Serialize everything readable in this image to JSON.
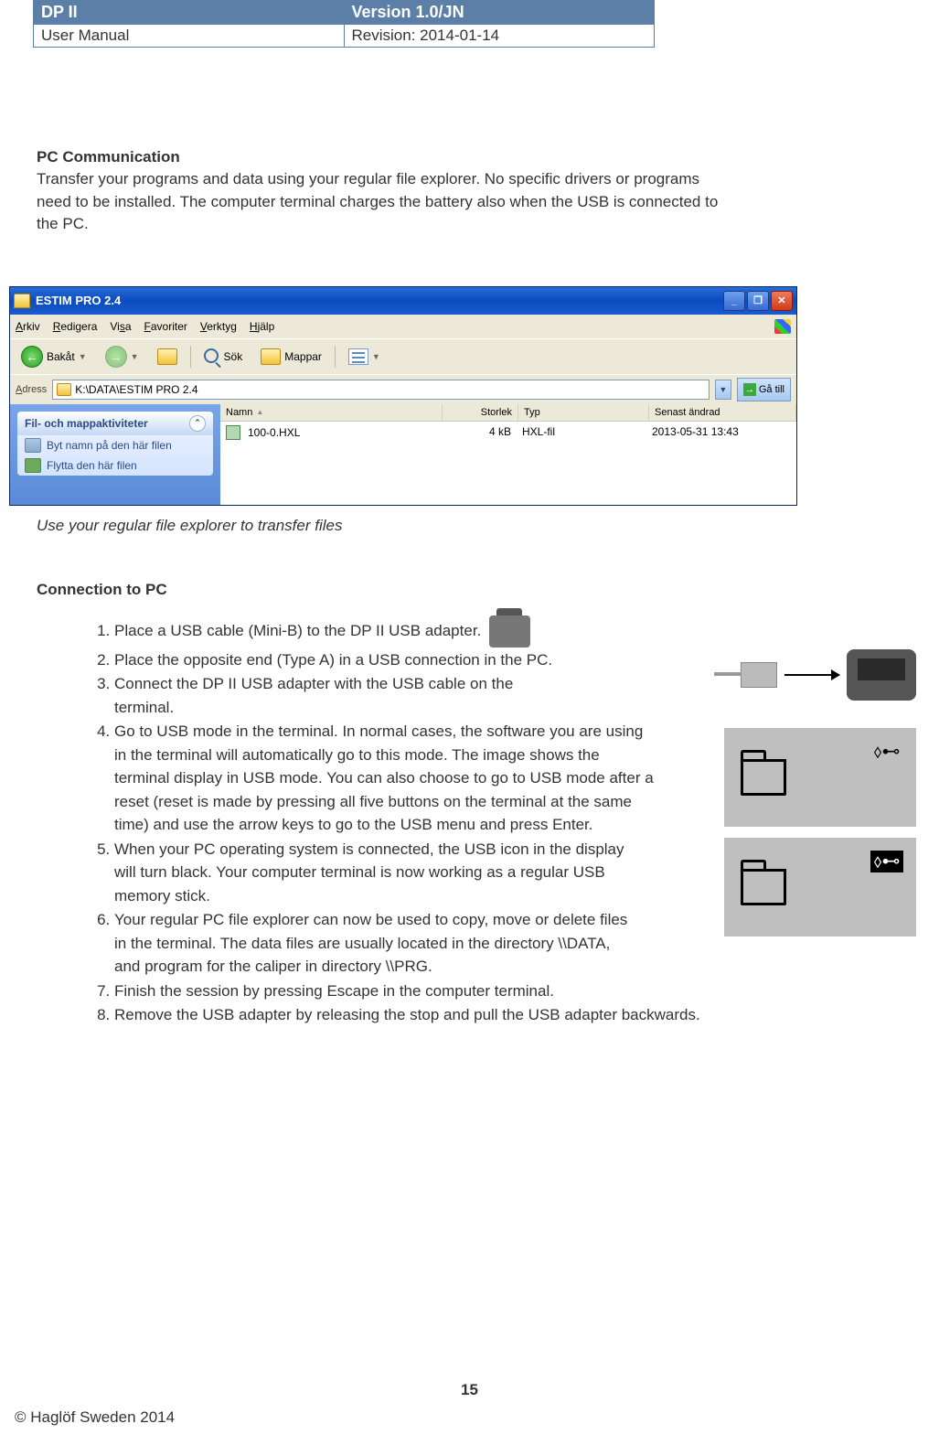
{
  "header": {
    "title": "DP II",
    "version": "Version 1.0/JN",
    "subtitle": "User Manual",
    "revision": "Revision: 2014-01-14"
  },
  "pc_comm": {
    "title": "PC Communication",
    "text": "Transfer your programs and data using your regular file explorer. No specific drivers or programs need to be installed. The computer terminal charges the battery also when the USB is connected to the PC."
  },
  "explorer": {
    "title": "ESTIM PRO 2.4",
    "menu": {
      "arkiv": "Arkiv",
      "redigera": "Redigera",
      "visa": "Visa",
      "favoriter": "Favoriter",
      "verktyg": "Verktyg",
      "hjalp": "Hjälp"
    },
    "toolbar": {
      "back": "Bakåt",
      "search": "Sök",
      "folders": "Mappar"
    },
    "address": {
      "label": "Adress",
      "value": "K:\\DATA\\ESTIM PRO 2.4",
      "go": "Gå till"
    },
    "tasks": {
      "head": "Fil- och mappaktiviteter",
      "rename": "Byt namn på den här filen",
      "move": "Flytta den här filen"
    },
    "cols": {
      "name": "Namn",
      "size": "Storlek",
      "type": "Typ",
      "date": "Senast ändrad"
    },
    "file": {
      "name": "100-0.HXL",
      "size": "4 kB",
      "type": "HXL-fil",
      "date": "2013-05-31 13:43"
    }
  },
  "explorer_caption": "Use your regular file explorer to transfer files",
  "conn": {
    "title": "Connection to PC",
    "steps": {
      "s1": "Place a USB cable (Mini-B) to the DP II USB adapter.",
      "s2": "Place the opposite end (Type A) in a USB connection in the PC.",
      "s3a": "Connect the DP II USB adapter with the USB cable on the",
      "s3b": " terminal.",
      "s4": "Go to USB mode in the terminal. In normal cases, the software you are using in the terminal will automatically go to this mode. The image shows the terminal display in USB mode. You can also choose to go to USB mode after a reset (reset is made by pressing all five buttons on the terminal at the same time) and use the arrow keys to go to the USB menu and press Enter.",
      "s5": "When your PC operating system is connected, the USB icon in the display will turn black. Your computer terminal is now working as a regular USB memory stick.",
      "s6": "Your regular PC file explorer can now be used to copy, move or delete files in the terminal. The data files are usually located in the directory \\\\DATA, and program for the caliper in directory \\\\PRG.",
      "s7": "Finish the session by pressing Escape in the computer terminal.",
      "s8": "Remove the USB adapter by releasing the stop and pull the USB adapter backwards."
    }
  },
  "footer": {
    "pagenum": "15",
    "copyright": "© Haglöf Sweden 2014"
  }
}
